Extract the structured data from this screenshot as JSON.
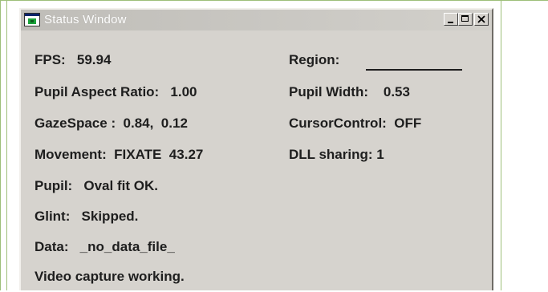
{
  "window": {
    "title": "Status Window"
  },
  "status": {
    "fps": "FPS:   59.94",
    "region": "Region:",
    "pupil_aspect_ratio": "Pupil Aspect Ratio:   1.00",
    "pupil_width": "Pupil Width:    0.53",
    "gaze_space": "GazeSpace :  0.84,  0.12",
    "cursor_control": "CursorControl:  OFF",
    "movement": "Movement:  FIXATE  43.27",
    "dll_sharing": "DLL sharing: 1",
    "pupil": "Pupil:   Oval fit OK.",
    "glint": "Glint:   Skipped.",
    "data": "Data:   _no_data_file_",
    "video": "Video capture working."
  },
  "colors": {
    "window_face": "#d6d3ce",
    "border_accent": "#9dbf7a",
    "icon_green": "#1aa33a"
  },
  "icons": [
    "app-window-icon",
    "minimize-icon",
    "maximize-icon",
    "close-icon"
  ]
}
